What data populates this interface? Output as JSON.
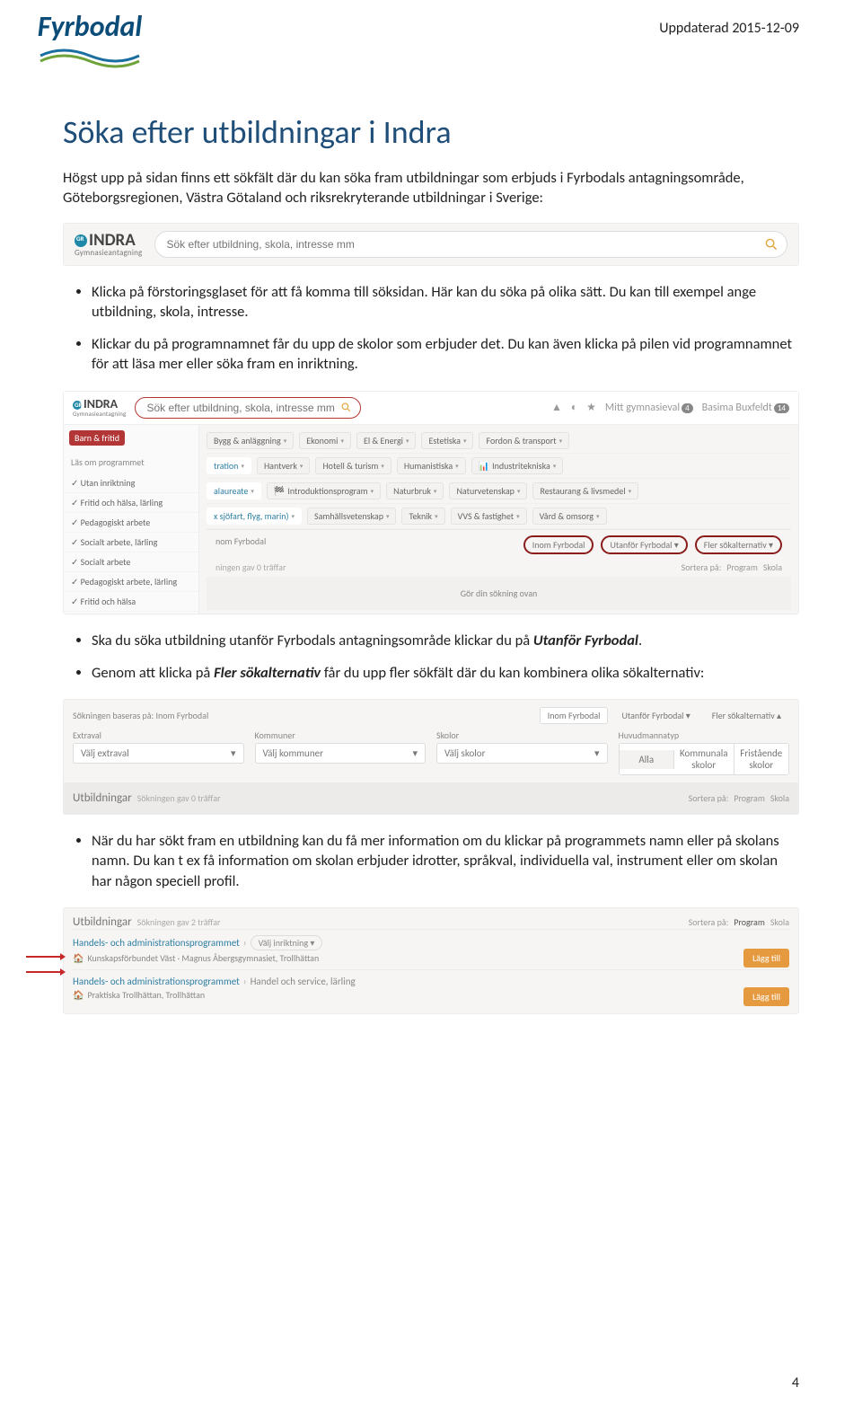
{
  "header": {
    "updated": "Uppdaterad 2015-12-09",
    "brand": "Fyrbodal"
  },
  "title": "Söka efter utbildningar i Indra",
  "intro": "Högst upp på sidan finns ett sökfält där du kan söka fram utbildningar som erbjuds i Fyrbodals antagningsområde, Göteborgsregionen, Västra Götaland och riksrekryterande utbildningar i Sverige:",
  "search1": {
    "placeholder": "Sök efter utbildning, skola, intresse mm",
    "brand": "INDRA",
    "sub": "Gymnasieantagning"
  },
  "bullets1": [
    "Klicka på förstoringsglaset för att få komma till söksidan. Här kan du söka på olika sätt. Du kan till exempel ange utbildning, skola, intresse.",
    "Klickar du på programnamnet får du upp de skolor som erbjuder det. Du kan även klicka på pilen vid programnamnet för att läsa mer eller söka fram en inriktning."
  ],
  "emb2": {
    "top": {
      "mitt": "Mitt gymnasieval",
      "mittBadge": "4",
      "user": "Basima Buxfeldt",
      "userBadge": "14"
    },
    "side": {
      "pill": "Barn & fritid",
      "label": "Läs om programmet",
      "items": [
        "Utan inriktning",
        "Fritid och hälsa, lärling",
        "Pedagogiskt arbete",
        "Socialt arbete, lärling",
        "Socialt arbete",
        "Pedagogiskt arbete, lärling",
        "Fritid och hälsa"
      ]
    },
    "rows": [
      [
        "Bygg & anläggning",
        "Ekonomi",
        "El & Energi",
        "Estetiska",
        "Fordon & transport"
      ],
      [
        "tration",
        "Hantverk",
        "Hotell & turism",
        "Humanistiska",
        "Industritekniska"
      ],
      [
        "alaureate",
        "Introduktionsprogram",
        "Naturbruk",
        "Naturvetenskap",
        "Restaurang & livsmedel"
      ],
      [
        "x sjöfart, flyg, marin)",
        "Samhällsvetenskap",
        "Teknik",
        "VVS & fastighet",
        "Vård & omsorg"
      ]
    ],
    "regionLine": "nom Fyrbodal",
    "rtabs": [
      "Inom Fyrbodal",
      "Utanför Fyrbodal",
      "Fler sökalternativ"
    ],
    "traff": "ningen gav 0 träffar",
    "sort": {
      "label": "Sortera på:",
      "a": "Program",
      "b": "Skola"
    },
    "empty": "Gör din sökning ovan"
  },
  "bullets2": {
    "a_pre": "Ska du söka utbildning utanför Fyrbodals antagningsområde klickar du på ",
    "a_em": "Utanför Fyrbodal",
    "a_post": ".",
    "b_pre": "Genom att klicka på ",
    "b_em": "Fler sökalternativ",
    "b_post": " får du upp fler sökfält där du kan kombinera olika sökalternativ:"
  },
  "emb3": {
    "baseras": "Sökningen baseras på: Inom Fyrbodal",
    "rtabs": [
      "Inom Fyrbodal",
      "Utanför Fyrbodal",
      "Fler sökalternativ"
    ],
    "cols": [
      {
        "label": "Extraval",
        "value": "Välj extraval"
      },
      {
        "label": "Kommuner",
        "value": "Välj kommuner"
      },
      {
        "label": "Skolor",
        "value": "Välj skolor"
      }
    ],
    "huvud": {
      "label": "Huvudmannatyp",
      "opts": [
        "Alla",
        "Kommunala skolor",
        "Fristående skolor"
      ]
    },
    "utb": "Utbildningar",
    "utbSub": "Sökningen gav 0 träffar",
    "sort": {
      "label": "Sortera på:",
      "a": "Program",
      "b": "Skola"
    }
  },
  "bullets3": [
    "När du har sökt fram en utbildning kan du få mer information om du klickar på programmets namn eller på skolans namn. Du kan t ex få information om skolan erbjuder idrotter, språkval, individuella val, instrument eller om skolan har någon speciell profil."
  ],
  "emb4": {
    "utb": "Utbildningar",
    "utbSub": "Sökningen gav 2 träffar",
    "sort": {
      "label": "Sortera på:",
      "a": "Program",
      "b": "Skola"
    },
    "res": [
      {
        "prog": "Handels- och administrationsprogrammet",
        "caret": "›",
        "valj": "Välj inriktning",
        "school": "Kunskapsförbundet Väst · Magnus Åbergsgymnasiet, Trollhättan"
      },
      {
        "prog": "Handels- och administrationsprogrammet",
        "caret": "›",
        "extra": "Handel och service, lärling",
        "school": "Praktiska Trollhättan, Trollhättan"
      }
    ],
    "lagg": "Lägg till"
  },
  "pageNum": "4"
}
